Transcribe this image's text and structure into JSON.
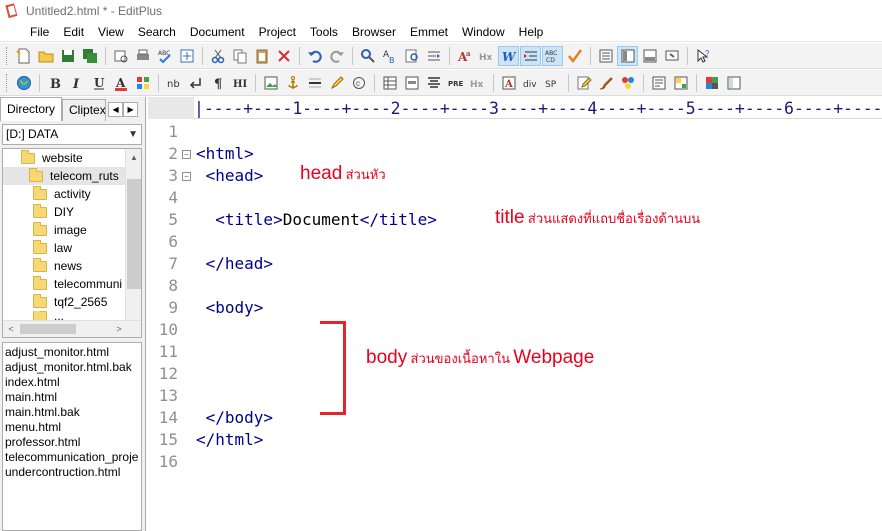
{
  "window": {
    "title": "Untitled2.html * - EditPlus"
  },
  "menu": [
    "File",
    "Edit",
    "View",
    "Search",
    "Document",
    "Project",
    "Tools",
    "Browser",
    "Emmet",
    "Window",
    "Help"
  ],
  "toolbar2_text": {
    "nb": "nb",
    "hi": "HI",
    "pre": "PRE",
    "hx": "Hx",
    "div": "div",
    "sp": "SP"
  },
  "left_panel": {
    "tabs": [
      "Directory",
      "Cliptext"
    ],
    "drive": "[D:] DATA",
    "folders": [
      "website",
      "telecom_ruts",
      "activity",
      "DIY",
      "image",
      "law",
      "news",
      "telecommuni",
      "tqf2_2565",
      "..."
    ],
    "files": [
      "adjust_monitor.html",
      "adjust_monitor.html.bak",
      "index.html",
      "main.html",
      "main.html.bak",
      "menu.html",
      "professor.html",
      "telecommunication_proje",
      "undercontruction.html"
    ]
  },
  "editor": {
    "ruler": "|----+----1----+----2----+----3----+----4----+----5----+----6----+----",
    "line_numbers": [
      "1",
      "2",
      "3",
      "4",
      "5",
      "6",
      "7",
      "8",
      "9",
      "10",
      "11",
      "12",
      "13",
      "14",
      "15",
      "16"
    ],
    "lines": {
      "l2": "<html>",
      "l3": " <head>",
      "l5_open": "  <title>",
      "l5_text": "Document",
      "l5_close": "</title>",
      "l7": " </head>",
      "l9": " <body>",
      "l14": " </body>",
      "l15": "</html>"
    }
  },
  "annotations": {
    "head_big": "head",
    "head_small": "ส่วนหัว",
    "title_big": "title",
    "title_small": "ส่วนแสดงที่แถบชื่อเรื่องด้านบน",
    "body_big": "body",
    "body_small": "ส่วนของเนื้อหาใน",
    "body_big2": "Webpage"
  },
  "colors": {
    "annotation": "#e8001c",
    "tag": "#00008b",
    "line_number": "#909090"
  }
}
